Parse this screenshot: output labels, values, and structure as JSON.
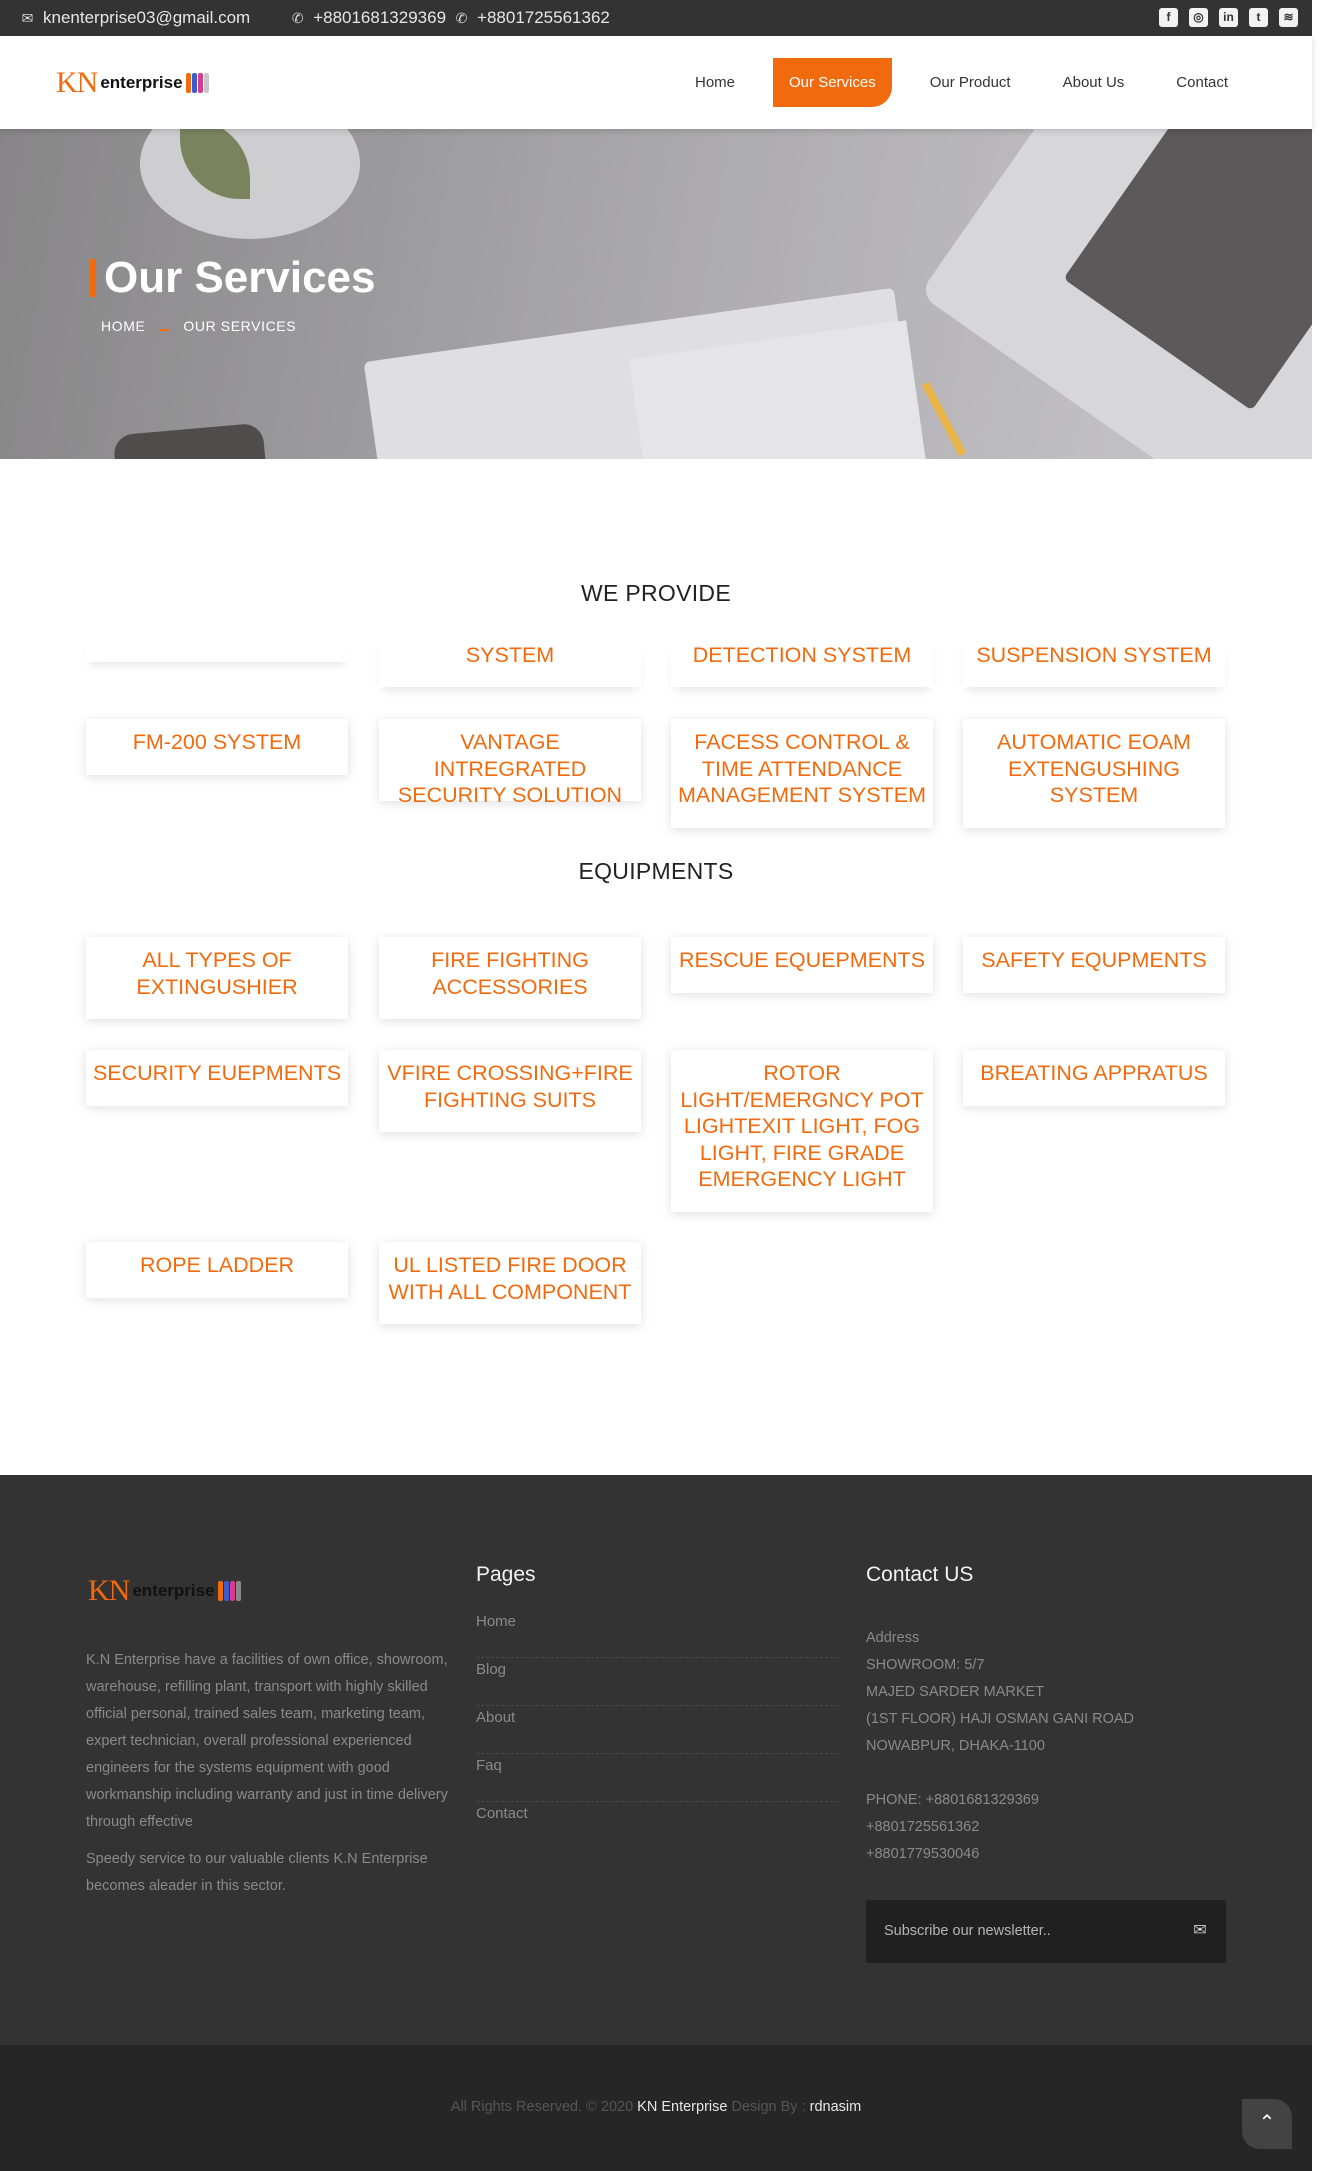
{
  "topbar": {
    "email": "knenterprise03@gmail.com",
    "phone1": "+8801681329369",
    "phone2": "+8801725561362",
    "socials": [
      "facebook-icon",
      "instagram-icon",
      "linkedin-icon",
      "twitter-icon",
      "rss-icon"
    ]
  },
  "header": {
    "logo_kn": "KN",
    "logo_text": "enterprise",
    "nav": [
      "Home",
      "Our Services",
      "Our Product",
      "About Us",
      "Contact"
    ],
    "active": "Our Services"
  },
  "hero": {
    "title": "Our Services",
    "crumb_home": "HOME",
    "crumb_current": "OUR SERVICES"
  },
  "provide": {
    "title": "WE PROVIDE",
    "row1": [
      "",
      "SYSTEM",
      "DETECTION SYSTEM",
      "SUSPENSION SYSTEM"
    ],
    "row2": [
      "FM-200 SYSTEM",
      "VANTAGE INTREGRATED SECURITY SOLUTION",
      "FACESS CONTROL & TIME ATTENDANCE MANAGEMENT SYSTEM",
      "AUTOMATIC EOAM EXTENGUSHING SYSTEM"
    ]
  },
  "equipments": {
    "title": "EQUIPMENTS",
    "items": [
      "ALL TYPES OF EXTINGUSHIER",
      "FIRE FIGHTING ACCESSORIES",
      "RESCUE EQUEPMENTS",
      "SAFETY EQUPMENTS",
      "SECURITY EUEPMENTS",
      "VFIRE CROSSING+FIRE FIGHTING SUITS",
      "ROTOR LIGHT/EMERGNCY POT LIGHTEXIT LIGHT, FOG LIGHT, FIRE GRADE EMERGENCY LIGHT",
      "BREATING APPRATUS",
      "ROPE LADDER",
      "UL LISTED FIRE DOOR WITH ALL COMPONENT"
    ]
  },
  "footer": {
    "logo_kn": "KN",
    "logo_text": "enterprise",
    "about1": "K.N Enterprise have a facilities of own office, showroom, warehouse, refilling plant, transport with highly skilled official personal, trained sales team, marketing team, expert technician, overall professional experienced engineers for the systems equipment with good workmanship including warranty and just in time delivery through effective",
    "about2": "Speedy service to our valuable clients K.N Enterprise becomes aleader in this sector.",
    "pages_title": "Pages",
    "pages": [
      "Home",
      "Blog",
      "About",
      "Faq",
      "Contact"
    ],
    "contact_title": "Contact US",
    "address_label": "Address",
    "address_lines": [
      "SHOWROOM: 5/7",
      "MAJED SARDER MARKET",
      "(1ST FLOOR) HAJI OSMAN GANI ROAD",
      "NOWABPUR, DHAKA-1100"
    ],
    "phone_line": "PHONE: +8801681329369",
    "phones_extra": [
      "+8801725561362",
      "+8801779530046"
    ],
    "newsletter_placeholder": "Subscribe our newsletter..",
    "copy_prefix": "All Rights Reserved. © 2020 ",
    "copy_brand": "KN Enterprise",
    "copy_mid": " Design By : ",
    "copy_author": "rdnasim"
  },
  "colors": {
    "accent": "#f26a0e",
    "dark": "#333333"
  }
}
